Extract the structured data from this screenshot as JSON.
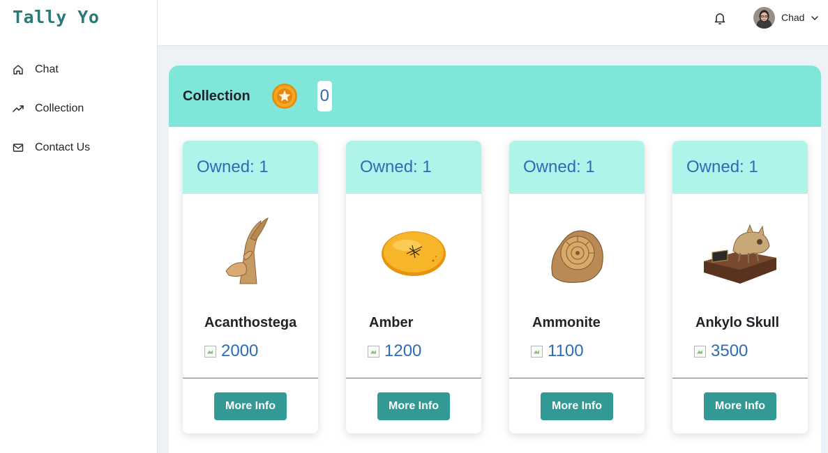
{
  "app": {
    "logo": "Tally Yo"
  },
  "sidebar": {
    "items": [
      {
        "label": "Chat",
        "icon": "home-icon"
      },
      {
        "label": "Collection",
        "icon": "trending-up-icon"
      },
      {
        "label": "Contact Us",
        "icon": "mail-icon"
      }
    ]
  },
  "topbar": {
    "username": "Chad",
    "bell_icon": "bell-icon",
    "chevron_icon": "chevron-down-icon"
  },
  "collection": {
    "title": "Collection",
    "coin_count": "0",
    "cards": [
      {
        "owned": "Owned: 1",
        "name": "Acanthostega",
        "price": "2000",
        "button": "More Info"
      },
      {
        "owned": "Owned: 1",
        "name": "Amber",
        "price": "1200",
        "button": "More Info"
      },
      {
        "owned": "Owned: 1",
        "name": "Ammonite",
        "price": "1100",
        "button": "More Info"
      },
      {
        "owned": "Owned: 1",
        "name": "Ankylo Skull",
        "price": "3500",
        "button": "More Info"
      }
    ]
  },
  "colors": {
    "logo": "#2b7a78",
    "header_bg": "#80e6da",
    "card_top_bg": "#b0f3ea",
    "accent_text": "#2d6cb5",
    "button_bg": "#339994"
  }
}
